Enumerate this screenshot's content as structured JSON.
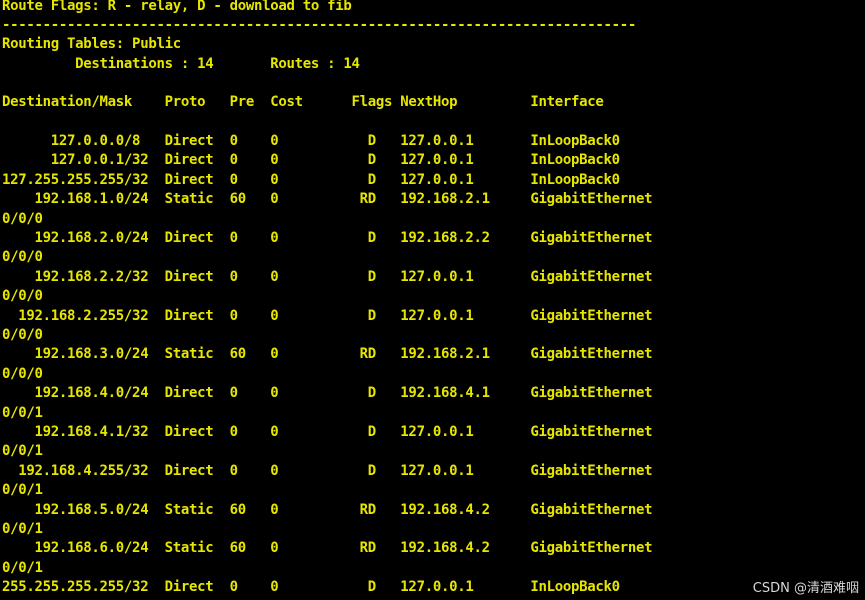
{
  "colors": {
    "background": "#000000",
    "text": "#e6e600",
    "watermark": "#d8d8d8"
  },
  "terminal": {
    "route_flags": "Route Flags: R - relay, D - download to fib",
    "separator": "------------------------------------------------------------------------------",
    "routing_tables": "Routing Tables: Public",
    "summary": "         Destinations : 14       Routes : 14",
    "blank_1": "",
    "column_header": "Destination/Mask    Proto   Pre  Cost      Flags NextHop         Interface",
    "blank_2": "",
    "rows": [
      {
        "line": "      127.0.0.0/8   Direct  0    0           D   127.0.0.1       InLoopBack0"
      },
      {
        "line": "      127.0.0.1/32  Direct  0    0           D   127.0.0.1       InLoopBack0"
      },
      {
        "line": "127.255.255.255/32  Direct  0    0           D   127.0.0.1       InLoopBack0"
      },
      {
        "line": "    192.168.1.0/24  Static  60   0          RD   192.168.2.1     GigabitEthernet"
      },
      {
        "line": "0/0/0"
      },
      {
        "line": "    192.168.2.0/24  Direct  0    0           D   192.168.2.2     GigabitEthernet"
      },
      {
        "line": "0/0/0"
      },
      {
        "line": "    192.168.2.2/32  Direct  0    0           D   127.0.0.1       GigabitEthernet"
      },
      {
        "line": "0/0/0"
      },
      {
        "line": "  192.168.2.255/32  Direct  0    0           D   127.0.0.1       GigabitEthernet"
      },
      {
        "line": "0/0/0"
      },
      {
        "line": "    192.168.3.0/24  Static  60   0          RD   192.168.2.1     GigabitEthernet"
      },
      {
        "line": "0/0/0"
      },
      {
        "line": "    192.168.4.0/24  Direct  0    0           D   192.168.4.1     GigabitEthernet"
      },
      {
        "line": "0/0/1"
      },
      {
        "line": "    192.168.4.1/32  Direct  0    0           D   127.0.0.1       GigabitEthernet"
      },
      {
        "line": "0/0/1"
      },
      {
        "line": "  192.168.4.255/32  Direct  0    0           D   127.0.0.1       GigabitEthernet"
      },
      {
        "line": "0/0/1"
      },
      {
        "line": "    192.168.5.0/24  Static  60   0          RD   192.168.4.2     GigabitEthernet"
      },
      {
        "line": "0/0/1"
      },
      {
        "line": "    192.168.6.0/24  Static  60   0          RD   192.168.4.2     GigabitEthernet"
      },
      {
        "line": "0/0/1"
      },
      {
        "line": "255.255.255.255/32  Direct  0    0           D   127.0.0.1       InLoopBack0"
      }
    ]
  },
  "watermark": "CSDN @清酒难咽"
}
